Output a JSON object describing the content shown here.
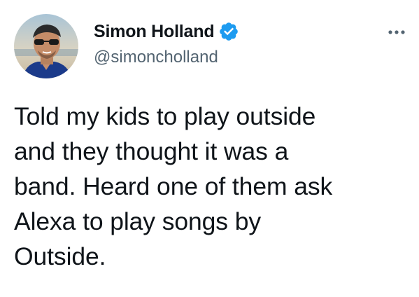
{
  "author": {
    "display_name": "Simon Holland",
    "handle": "@simoncholland",
    "verified": true,
    "verified_icon": "verified-badge-icon",
    "avatar_icon": "profile-avatar"
  },
  "tweet": {
    "text": "Told my kids to play outside\nand they thought it was a\nband. Heard one of them ask\nAlexa to play songs by\nOutside."
  },
  "menu": {
    "more_icon": "more-options-icon"
  },
  "colors": {
    "text_primary": "#0f1419",
    "text_secondary": "#536471",
    "verified_blue": "#1d9bf0",
    "background": "#ffffff"
  }
}
